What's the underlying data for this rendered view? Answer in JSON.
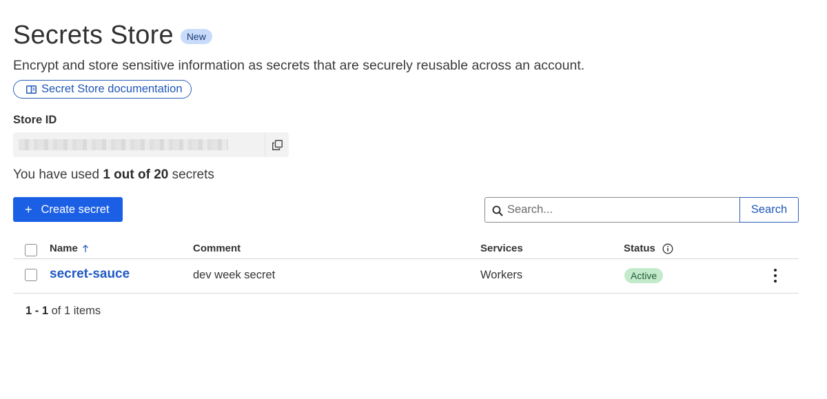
{
  "header": {
    "title": "Secrets Store",
    "badge": "New"
  },
  "subtitle": "Encrypt and store sensitive information as secrets that are securely reusable across an account.",
  "doc_link": {
    "label": "Secret Store documentation",
    "icon": "book-icon"
  },
  "store": {
    "label": "Store ID",
    "value": "a",
    "copy_icon": "copy-icon"
  },
  "usage": {
    "prefix": "You have used",
    "used": "1",
    "out_of": "out of",
    "limit": "20",
    "suffix": "secrets"
  },
  "toolbar": {
    "create_label": "Create secret",
    "search_placeholder": "Search...",
    "search_label": "Search"
  },
  "table": {
    "columns": {
      "name": "Name",
      "comment": "Comment",
      "services": "Services",
      "status": "Status"
    },
    "rows": [
      {
        "name": "secret-sauce",
        "comment": "dev week secret",
        "services": "Workers",
        "status": "Active"
      }
    ]
  },
  "pagination": {
    "range": "1 - 1",
    "of": "of 1 items"
  },
  "colors": {
    "primary": "#1b5fe5",
    "link": "#2059c4",
    "active_bg": "#c3ebcb",
    "new_bg": "#c9dbfb"
  }
}
